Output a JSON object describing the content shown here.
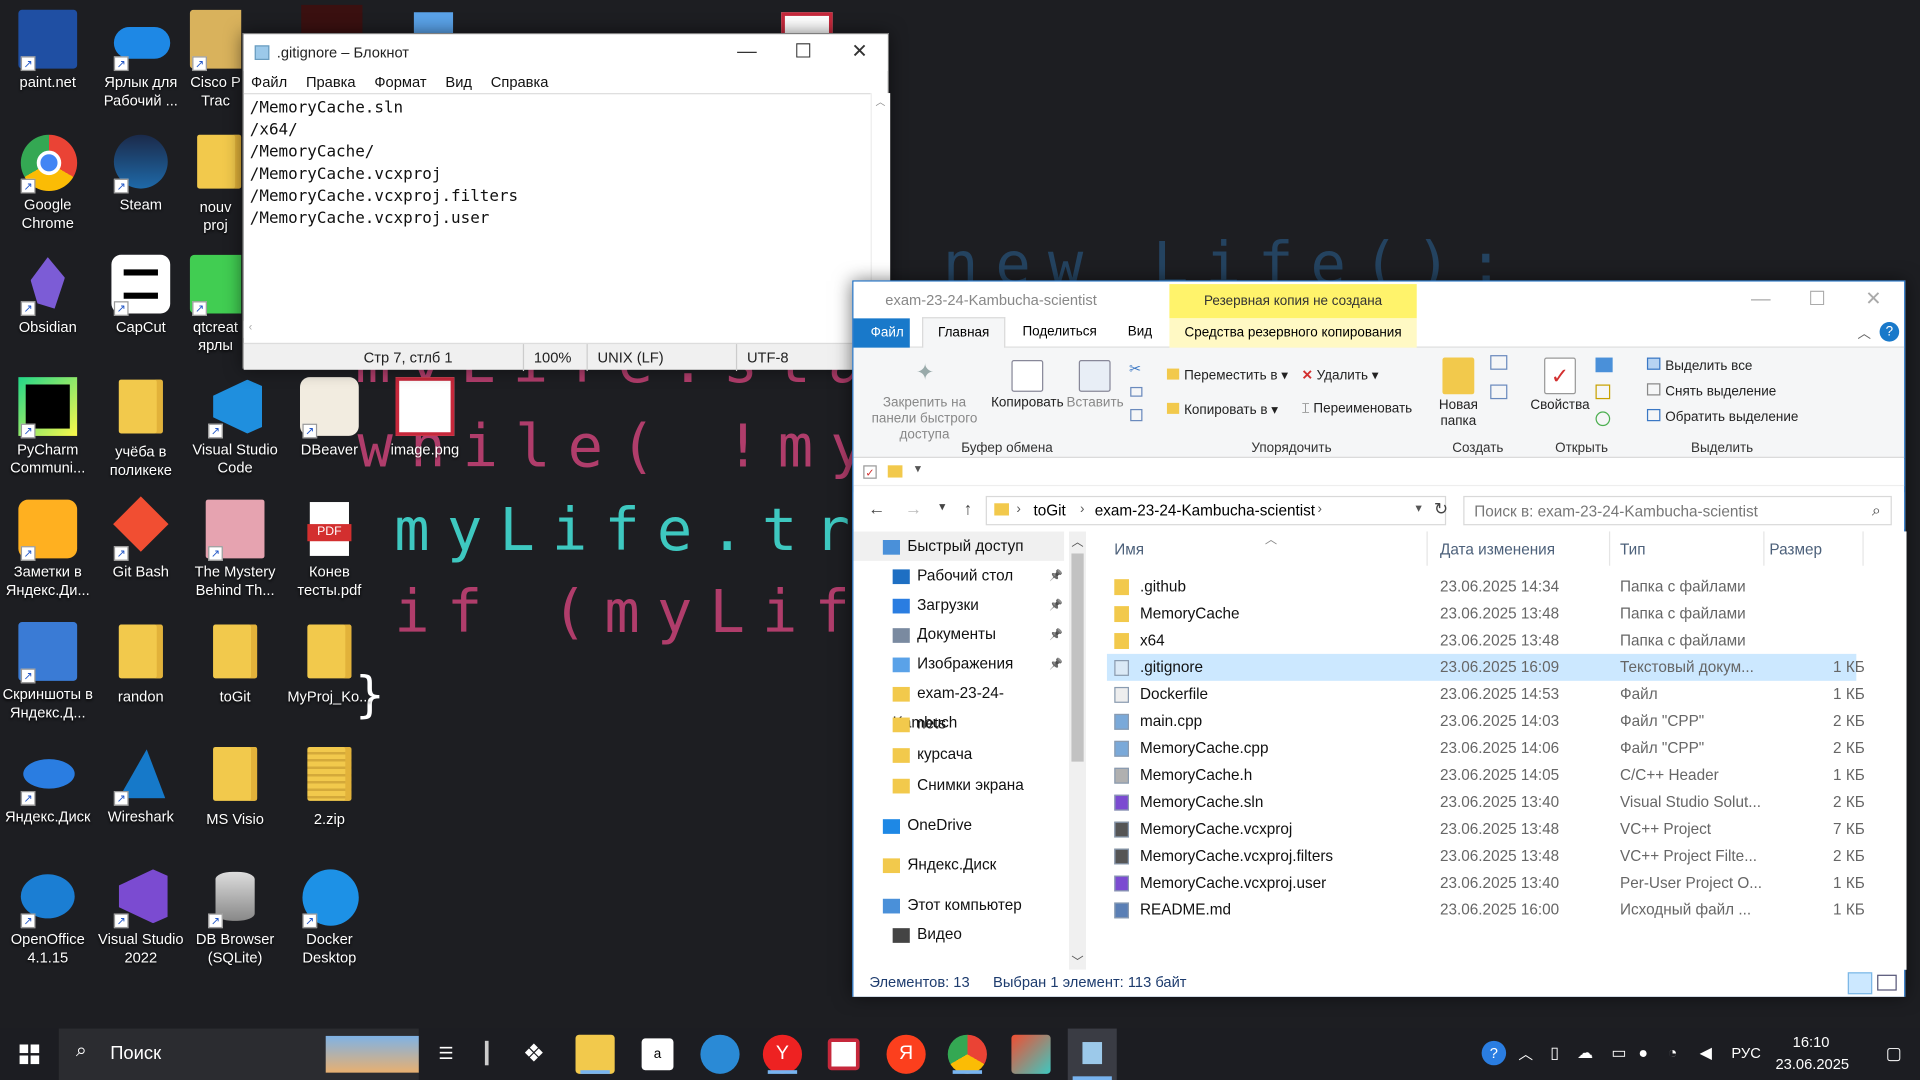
{
  "desktop": {
    "icons": [
      {
        "name": "paintnet",
        "label": "paint.net"
      },
      {
        "name": "yandex-desktop",
        "label": "Ярлык для Рабочий ..."
      },
      {
        "name": "cisco",
        "label": "Cisco P Trac"
      },
      {
        "name": "chrome",
        "label": "Google Chrome"
      },
      {
        "name": "steam",
        "label": "Steam"
      },
      {
        "name": "nouv",
        "label": "nouv proj"
      },
      {
        "name": "obsidian",
        "label": "Obsidian"
      },
      {
        "name": "capcut",
        "label": "CapCut"
      },
      {
        "name": "qtcreator",
        "label": "qtcreat ярлы"
      },
      {
        "name": "pycharm",
        "label": "PyCharm Communi..."
      },
      {
        "name": "ucheba",
        "label": "учёба в поликеке"
      },
      {
        "name": "vscode",
        "label": "Visual Studio Code"
      },
      {
        "name": "dbeaver",
        "label": "DBeaver"
      },
      {
        "name": "imagepng",
        "label": "image.png"
      },
      {
        "name": "zametki",
        "label": "Заметки в Яндекс.Ди..."
      },
      {
        "name": "gitbash",
        "label": "Git Bash"
      },
      {
        "name": "mystery",
        "label": "The Mystery Behind Th..."
      },
      {
        "name": "konev",
        "label": "Конев тесты.pdf"
      },
      {
        "name": "screenshots",
        "label": "Скриншоты в Яндекс.Д..."
      },
      {
        "name": "randon",
        "label": "randon"
      },
      {
        "name": "togit",
        "label": "toGit"
      },
      {
        "name": "myproj",
        "label": "MyProj_Ko..."
      },
      {
        "name": "yadisk",
        "label": "Яндекс.Диск"
      },
      {
        "name": "wireshark",
        "label": "Wireshark"
      },
      {
        "name": "msvisio",
        "label": "MS Visio"
      },
      {
        "name": "zip",
        "label": "2.zip"
      },
      {
        "name": "openoffice",
        "label": "OpenOffice 4.1.15"
      },
      {
        "name": "vs2022",
        "label": "Visual Studio 2022"
      },
      {
        "name": "dbbrowser",
        "label": "DB Browser (SQLite)"
      },
      {
        "name": "docker",
        "label": "Docker Desktop"
      }
    ],
    "code_lines": [
      "new Life();",
      "myLife.start",
      "while( !myLi",
      "myLife.tryA",
      "if (myLife."
    ],
    "brace": "}"
  },
  "notepad": {
    "title": ".gitignore – Блокнот",
    "menu": [
      "Файл",
      "Правка",
      "Формат",
      "Вид",
      "Справка"
    ],
    "lines": [
      "/MemoryCache.sln",
      "/x64/",
      "/MemoryCache/",
      "/MemoryCache.vcxproj",
      "/MemoryCache.vcxproj.filters",
      "/MemoryCache.vcxproj.user"
    ],
    "status": {
      "position": "Стр 7, стлб 1",
      "zoom": "100%",
      "eol": "UNIX (LF)",
      "encoding": "UTF-8"
    }
  },
  "explorer": {
    "title": "exam-23-24-Kambucha-scientist",
    "backup_banner": "Резервная копия не создана",
    "tabs": [
      "Файл",
      "Главная",
      "Поделиться",
      "Вид",
      "Средства резервного копирования"
    ],
    "ribbon": {
      "pin": "Закрепить на панели быстрого доступа",
      "copy": "Копировать",
      "paste": "Вставить",
      "move_to": "Переместить в",
      "copy_to": "Копировать в",
      "delete": "Удалить",
      "rename": "Переименовать",
      "new_folder": "Новая папка",
      "properties": "Свойства",
      "select_all": "Выделить все",
      "deselect": "Снять выделение",
      "invert": "Обратить выделение",
      "groups": [
        "Буфер обмена",
        "Упорядочить",
        "Создать",
        "Открыть",
        "Выделить"
      ]
    },
    "breadcrumb": [
      "toGit",
      "exam-23-24-Kambucha-scientist"
    ],
    "search_placeholder": "Поиск в: exam-23-24-Kambucha-scientist",
    "columns": [
      "Имя",
      "Дата изменения",
      "Тип",
      "Размер"
    ],
    "nav": [
      {
        "label": "Быстрый доступ",
        "level": 0,
        "pin": false
      },
      {
        "label": "Рабочий стол",
        "level": 1,
        "pin": true
      },
      {
        "label": "Загрузки",
        "level": 1,
        "pin": true
      },
      {
        "label": "Документы",
        "level": 1,
        "pin": true
      },
      {
        "label": "Изображения",
        "level": 1,
        "pin": true
      },
      {
        "label": "exam-23-24-Kambuch",
        "level": 1,
        "pin": false
      },
      {
        "label": "nets",
        "level": 1,
        "pin": false
      },
      {
        "label": "курсача",
        "level": 1,
        "pin": false
      },
      {
        "label": "Снимки экрана",
        "level": 1,
        "pin": false
      },
      {
        "label": "OneDrive",
        "level": 0,
        "pin": false
      },
      {
        "label": "Яндекс.Диск",
        "level": 0,
        "pin": false
      },
      {
        "label": "Этот компьютер",
        "level": 0,
        "pin": false
      },
      {
        "label": "Видео",
        "level": 1,
        "pin": false
      }
    ],
    "files": [
      {
        "name": ".github",
        "date": "23.06.2025 14:34",
        "type": "Папка с файлами",
        "size": "",
        "kind": "folder"
      },
      {
        "name": "MemoryCache",
        "date": "23.06.2025 13:48",
        "type": "Папка с файлами",
        "size": "",
        "kind": "folder"
      },
      {
        "name": "x64",
        "date": "23.06.2025 13:48",
        "type": "Папка с файлами",
        "size": "",
        "kind": "folder"
      },
      {
        "name": ".gitignore",
        "date": "23.06.2025 16:09",
        "type": "Текстовый докум...",
        "size": "1 КБ",
        "kind": "text",
        "selected": true
      },
      {
        "name": "Dockerfile",
        "date": "23.06.2025 14:53",
        "type": "Файл",
        "size": "1 КБ",
        "kind": "file"
      },
      {
        "name": "main.cpp",
        "date": "23.06.2025 14:03",
        "type": "Файл \"CPP\"",
        "size": "2 КБ",
        "kind": "cpp"
      },
      {
        "name": "MemoryCache.cpp",
        "date": "23.06.2025 14:06",
        "type": "Файл \"CPP\"",
        "size": "2 КБ",
        "kind": "cpp"
      },
      {
        "name": "MemoryCache.h",
        "date": "23.06.2025 14:05",
        "type": "C/C++ Header",
        "size": "1 КБ",
        "kind": "h"
      },
      {
        "name": "MemoryCache.sln",
        "date": "23.06.2025 13:40",
        "type": "Visual Studio Solut...",
        "size": "2 КБ",
        "kind": "sln"
      },
      {
        "name": "MemoryCache.vcxproj",
        "date": "23.06.2025 13:48",
        "type": "VC++ Project",
        "size": "7 КБ",
        "kind": "proj"
      },
      {
        "name": "MemoryCache.vcxproj.filters",
        "date": "23.06.2025 13:48",
        "type": "VC++ Project Filte...",
        "size": "2 КБ",
        "kind": "proj"
      },
      {
        "name": "MemoryCache.vcxproj.user",
        "date": "23.06.2025 13:40",
        "type": "Per-User Project O...",
        "size": "1 КБ",
        "kind": "user"
      },
      {
        "name": "README.md",
        "date": "23.06.2025 16:00",
        "type": "Исходный файл ...",
        "size": "1 КБ",
        "kind": "md"
      }
    ],
    "status_count": "Элементов: 13",
    "status_selected": "Выбран 1 элемент: 113 байт"
  },
  "taskbar": {
    "search": "Поиск",
    "lang": "РУС",
    "time": "16:10",
    "date": "23.06.2025"
  },
  "colors": {
    "accent": "#0078d7",
    "selection": "#cce8ff",
    "code_pink": "#b03d6b",
    "code_teal": "#3ec8c0",
    "backup_banner": "#fff36b"
  }
}
